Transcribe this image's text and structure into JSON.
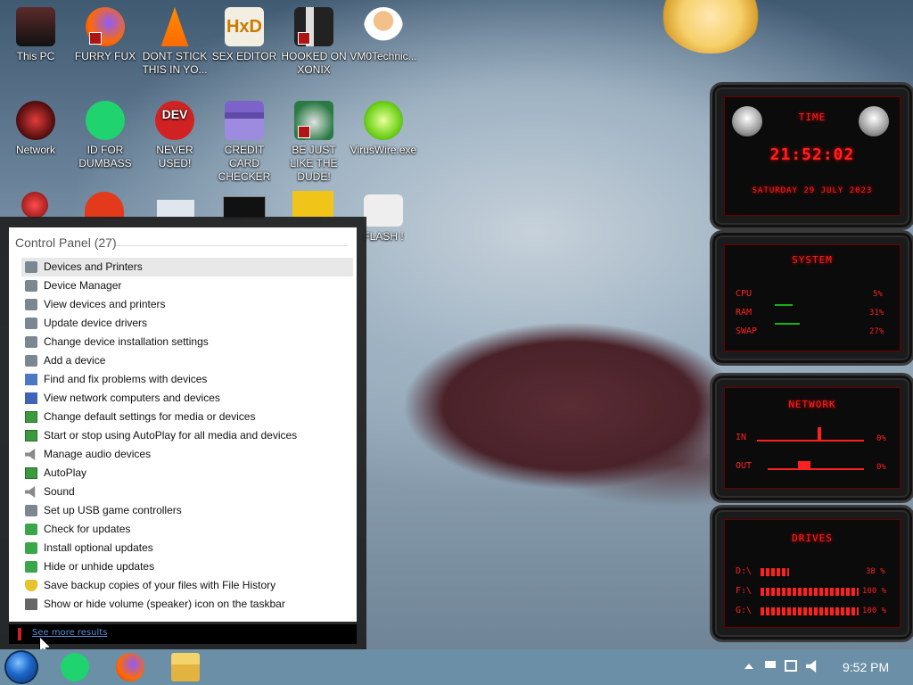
{
  "desktop": {
    "icons": [
      {
        "label": "This PC"
      },
      {
        "label": "FURRY FUX"
      },
      {
        "label": "DONT STICK THIS IN YO..."
      },
      {
        "label": "SEX EDITOR"
      },
      {
        "label": "HOOKED ON XONIX"
      },
      {
        "label": "VM0Technic..."
      },
      {
        "label": "Network"
      },
      {
        "label": "ID FOR DUMBASS"
      },
      {
        "label": "NEVER USED!"
      },
      {
        "label": "CREDIT CARD CHECKER"
      },
      {
        "label": "BE JUST LIKE THE DUDE!"
      },
      {
        "label": "VirusWire.exe"
      },
      {
        "label": "FLASH !"
      }
    ],
    "dev_icon_text": "DEV",
    "hxd_icon_text": "HxD"
  },
  "start_menu": {
    "group_header": "Control Panel (27)",
    "items": [
      {
        "label": "Devices and Printers",
        "icon": "printer-icon"
      },
      {
        "label": "Device Manager",
        "icon": "printer-icon"
      },
      {
        "label": "View devices and printers",
        "icon": "printer-icon"
      },
      {
        "label": "Update device drivers",
        "icon": "printer-icon"
      },
      {
        "label": "Change device installation settings",
        "icon": "printer-icon"
      },
      {
        "label": "Add a device",
        "icon": "printer-icon"
      },
      {
        "label": "Find and fix problems with devices",
        "icon": "troubleshoot-icon"
      },
      {
        "label": "View network computers and devices",
        "icon": "network-icon"
      },
      {
        "label": "Change default settings for media or devices",
        "icon": "autoplay-icon"
      },
      {
        "label": "Start or stop using AutoPlay for all media and devices",
        "icon": "autoplay-icon"
      },
      {
        "label": "Manage audio devices",
        "icon": "speaker-icon"
      },
      {
        "label": "AutoPlay",
        "icon": "autoplay-icon"
      },
      {
        "label": "Sound",
        "icon": "speaker-icon"
      },
      {
        "label": "Set up USB game controllers",
        "icon": "printer-icon"
      },
      {
        "label": "Check for updates",
        "icon": "windows-update-icon"
      },
      {
        "label": "Install optional updates",
        "icon": "windows-update-icon"
      },
      {
        "label": "Hide or unhide updates",
        "icon": "windows-update-icon"
      },
      {
        "label": "Save backup copies of your files with File History",
        "icon": "file-history-icon"
      },
      {
        "label": "Show or hide volume (speaker) icon on the taskbar",
        "icon": "taskbar-icon"
      }
    ],
    "selected_index": 0,
    "see_more_link": "See more results"
  },
  "gadget": {
    "time": {
      "title": "TIME",
      "clock": "21:52:02",
      "date": "SATURDAY 29 JULY 2023"
    },
    "system": {
      "title": "SYSTEM",
      "rows": [
        {
          "label": "CPU",
          "value": "5%",
          "level": 0.05
        },
        {
          "label": "RAM",
          "value": "31%",
          "level": 0.31
        },
        {
          "label": "SWAP",
          "value": "27%",
          "level": 0.27
        }
      ]
    },
    "network": {
      "title": "NETWORK",
      "rows": [
        {
          "label": "IN",
          "value": "0%"
        },
        {
          "label": "OUT",
          "value": "0%"
        }
      ]
    },
    "drives": {
      "title": "DRIVES",
      "rows": [
        {
          "label": "D:\\",
          "value": "38 %",
          "level": 0.38
        },
        {
          "label": "F:\\",
          "value": "100 %",
          "level": 1.0
        },
        {
          "label": "G:\\",
          "value": "100 %",
          "level": 1.0
        }
      ]
    },
    "accent_color": "#ff2020"
  },
  "taskbar": {
    "clock": "9:52 PM",
    "pinned": [
      "start-orb",
      "green-notes-app",
      "firefox",
      "file-explorer"
    ],
    "tray_icons": [
      "chevron-up-icon",
      "flag-icon",
      "network-icon",
      "speaker-icon"
    ]
  }
}
